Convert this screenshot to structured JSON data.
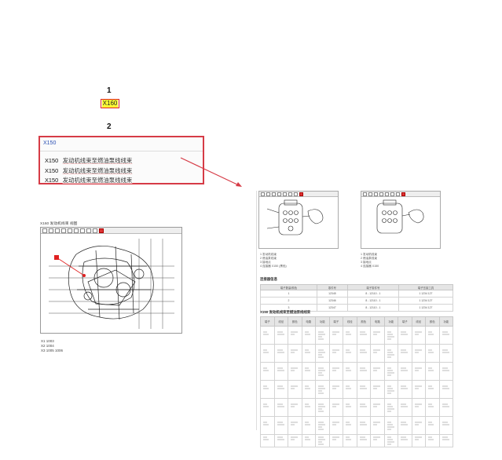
{
  "steps": {
    "one": "1",
    "two": "2"
  },
  "connector_code": "X160",
  "search": {
    "query": "X150",
    "results": [
      {
        "code": "X150",
        "desc": "发动机线束至燃油泵线线束"
      },
      {
        "code": "X150",
        "desc": "发动机线束至燃油泵线线束"
      },
      {
        "code": "X150",
        "desc": "发动机线束至燃油泵线线束"
      }
    ]
  },
  "left_viewer": {
    "title": "X160 发动机线束 视图",
    "captions": [
      "X1 1003",
      "X2 1004",
      "X3 1005 1006"
    ]
  },
  "right_doc": {
    "notes_left": [
      "1 发动机线束",
      "2 燃油泵线束",
      "3 接地点",
      "4 连接器 X150 (黑色)"
    ],
    "notes_right": [
      "1 发动机线束",
      "2 燃油泵线束",
      "3 接地点",
      "4 连接器 X150"
    ],
    "table1_title": "连接器信息",
    "table1_headers": [
      "端子数量/颜色",
      "零件号",
      "端子零件号",
      "端子压接工具"
    ],
    "table1_rows": [
      [
        "1",
        "12345",
        "8 - 12110 - 1",
        "1 1234 127"
      ],
      [
        "2",
        "12346",
        "8 - 12110 - 1",
        "1 1234 127"
      ],
      [
        "3",
        "12347",
        "8 - 12110 - 1",
        "1 1234 127"
      ]
    ],
    "table2_title": "X150 发动机线束至燃油泵线线束",
    "table2_headers": [
      "端子",
      "线径",
      "颜色",
      "电路",
      "功能",
      "端子",
      "线径",
      "颜色",
      "电路",
      "功能",
      "端子",
      "线径",
      "颜色",
      "功能"
    ],
    "table2_rows": 7
  }
}
